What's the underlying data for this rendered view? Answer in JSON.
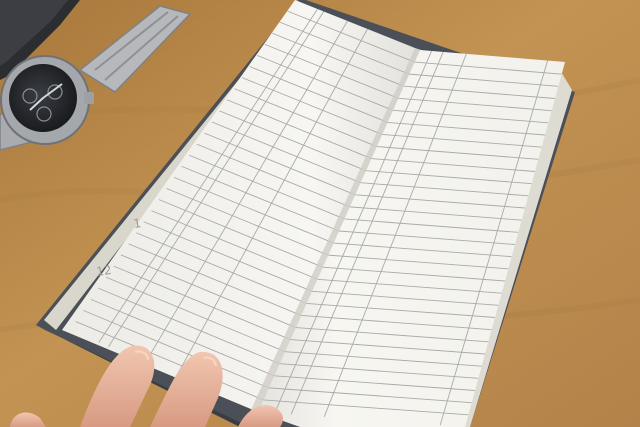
{
  "photo": {
    "subject": "open-vertical-notebook-on-desk",
    "colors": {
      "desk": "#bb8c4b",
      "desk_dark": "#9c6f36",
      "page": "#f6f5f0",
      "page_shadow": "#e6e4dd",
      "rule_line": "#a9aaa8",
      "cover": "#4b4f57",
      "watch_steel": "#b6b8bb",
      "watch_dial": "#2b2d31",
      "skin": "#e8b7a0"
    },
    "margin_labels": [
      "1",
      "12"
    ]
  }
}
